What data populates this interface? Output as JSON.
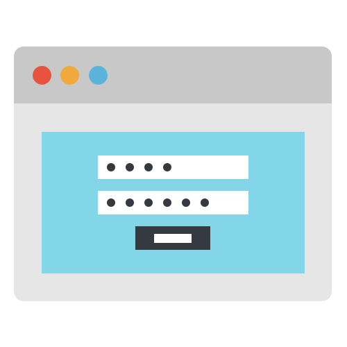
{
  "colors": {
    "window_body": "#e6e6e6",
    "titlebar": "#c8c8c8",
    "close_dot": "#e8533f",
    "minimize_dot": "#f0a93b",
    "maximize_dot": "#5ab4dc",
    "content_panel": "#83d6e8",
    "field_background": "#ffffff",
    "mask_dot": "#343a40",
    "submit_button": "#343a40"
  },
  "window_controls": [
    {
      "icon": "close-dot-icon"
    },
    {
      "icon": "minimize-dot-icon"
    },
    {
      "icon": "maximize-dot-icon"
    }
  ],
  "login_form": {
    "username_field": {
      "masked_characters": 4,
      "icon": "masked-dot-icon"
    },
    "password_field": {
      "masked_characters": 6,
      "icon": "masked-dot-icon"
    },
    "submit_button": {
      "label_icon": "blank-label-bar-icon"
    }
  }
}
